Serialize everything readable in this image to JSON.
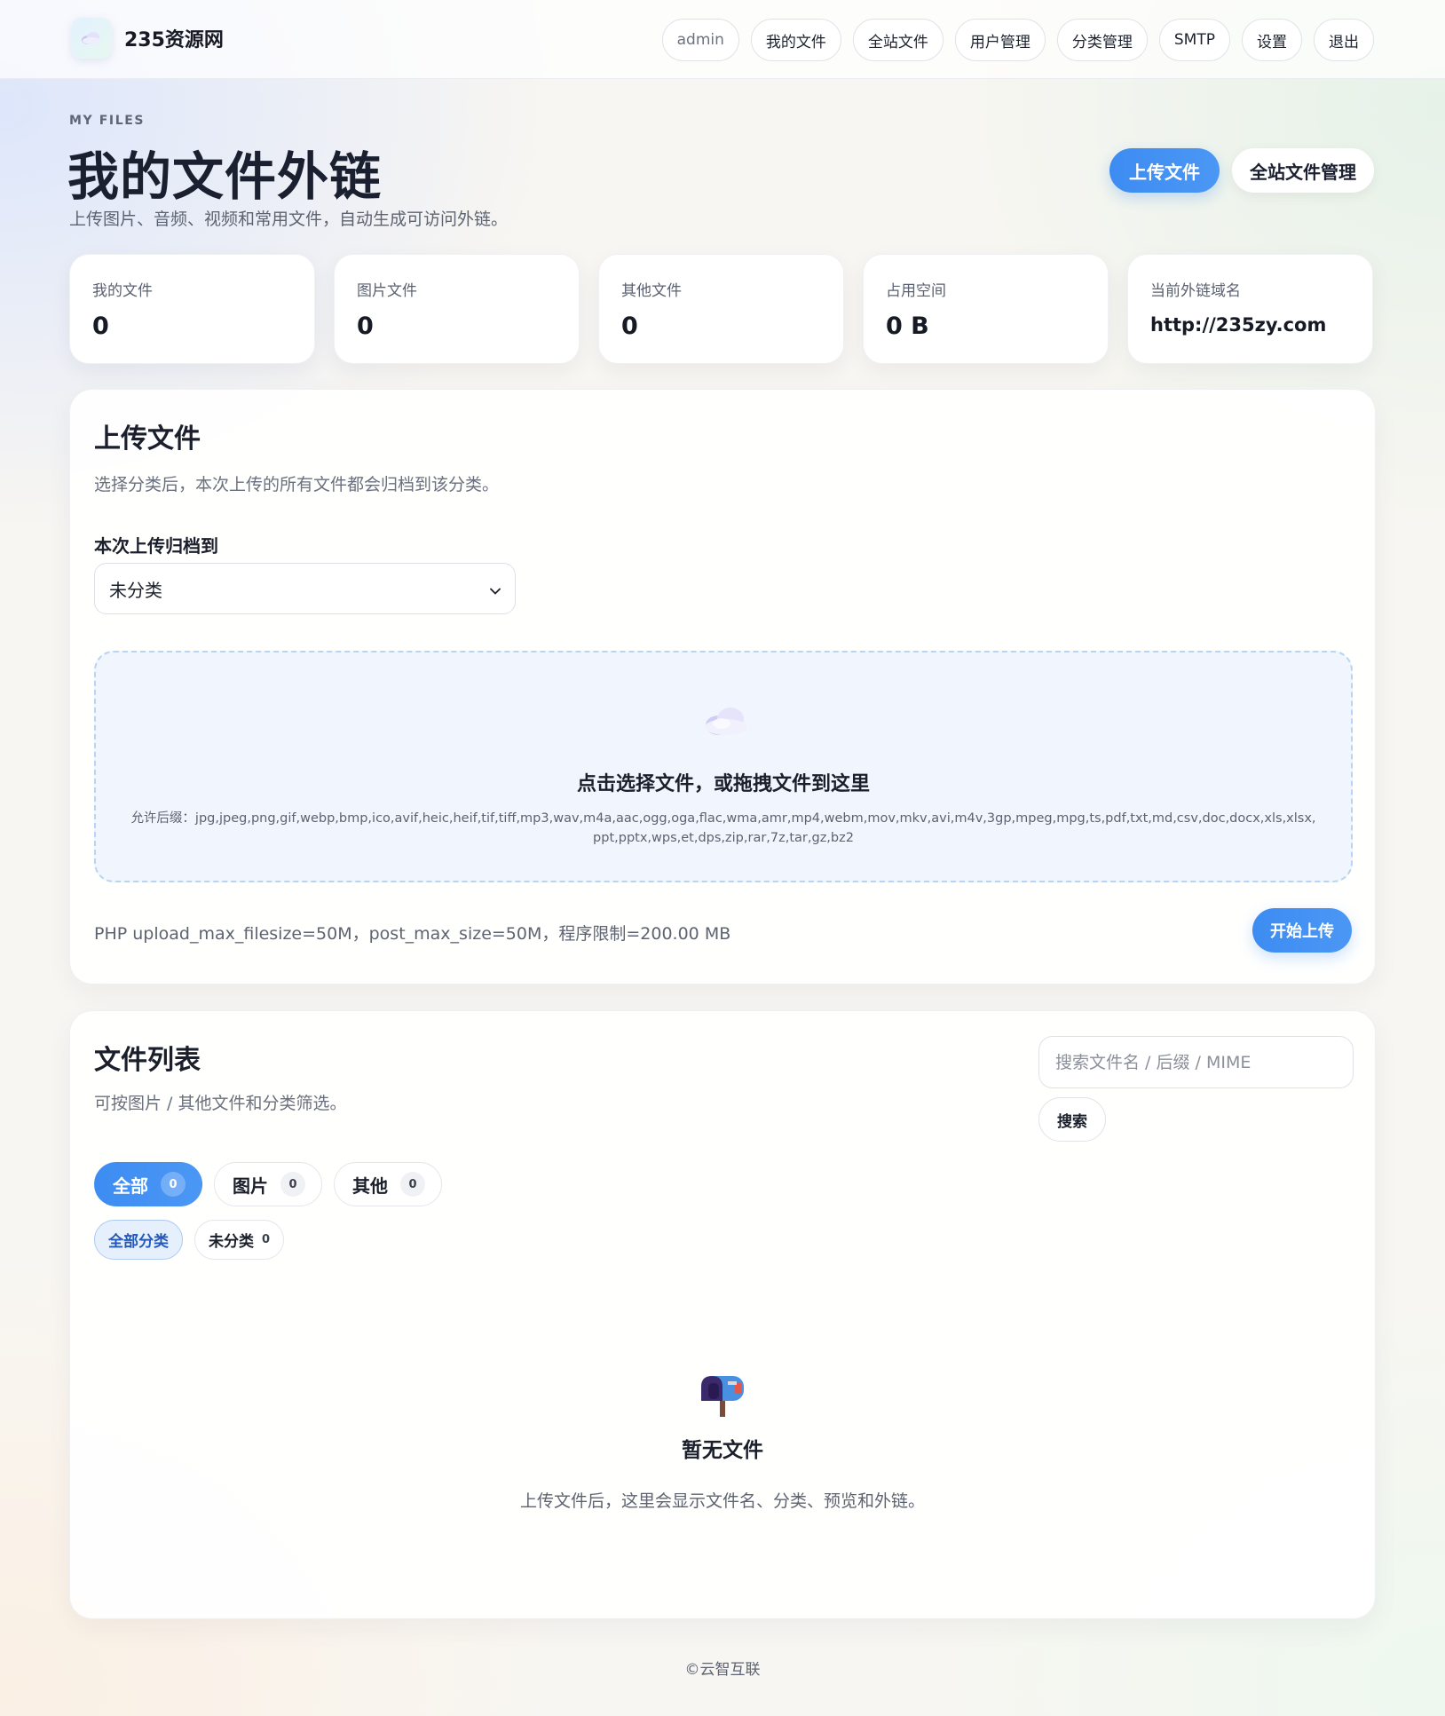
{
  "brand": {
    "name": "235资源网"
  },
  "nav": {
    "user": "admin",
    "items": [
      "我的文件",
      "全站文件",
      "用户管理",
      "分类管理",
      "SMTP",
      "设置",
      "退出"
    ]
  },
  "hero": {
    "eyebrow": "MY FILES",
    "title": "我的文件外链",
    "subtitle": "上传图片、音频、视频和常用文件，自动生成可访问外链。",
    "upload_btn": "上传文件",
    "all_files_btn": "全站文件管理"
  },
  "stats": [
    {
      "label": "我的文件",
      "value": "0"
    },
    {
      "label": "图片文件",
      "value": "0"
    },
    {
      "label": "其他文件",
      "value": "0"
    },
    {
      "label": "占用空间",
      "value": "0 B"
    },
    {
      "label": "当前外链域名",
      "value": "http://235zy.com"
    }
  ],
  "upload": {
    "title": "上传文件",
    "description": "选择分类后，本次上传的所有文件都会归档到该分类。",
    "category_label": "本次上传归档到",
    "category_value": "未分类",
    "dropzone_title": "点击选择文件，或拖拽文件到这里",
    "allowed_ext": "允许后缀：jpg,jpeg,png,gif,webp,bmp,ico,avif,heic,heif,tif,tiff,mp3,wav,m4a,aac,ogg,oga,flac,wma,amr,mp4,webm,mov,mkv,avi,m4v,3gp,mpeg,mpg,ts,pdf,txt,md,csv,doc,docx,xls,xlsx,ppt,pptx,wps,et,dps,zip,rar,7z,tar,gz,bz2",
    "limits": "PHP upload_max_filesize=50M，post_max_size=50M，程序限制=200.00 MB",
    "start_btn": "开始上传"
  },
  "list": {
    "title": "文件列表",
    "description": "可按图片 / 其他文件和分类筛选。",
    "search_placeholder": "搜索文件名 / 后缀 / MIME",
    "search_btn": "搜索",
    "type_tabs": [
      {
        "label": "全部",
        "count": "0"
      },
      {
        "label": "图片",
        "count": "0"
      },
      {
        "label": "其他",
        "count": "0"
      }
    ],
    "category_tabs": [
      {
        "label": "全部分类",
        "count": ""
      },
      {
        "label": "未分类",
        "count": "0"
      }
    ],
    "empty_title": "暂无文件",
    "empty_desc": "上传文件后，这里会显示文件名、分类、预览和外链。"
  },
  "footer": "©云智互联",
  "colors": {
    "accent": "#3d8cf2",
    "active_category_bg": "#e6f0fd",
    "active_category_text": "#2559b8"
  },
  "icons": {
    "brand": "cloud-icon",
    "dropzone": "cloud-icon",
    "empty": "mailbox-icon",
    "select": "chevron-down-icon"
  }
}
